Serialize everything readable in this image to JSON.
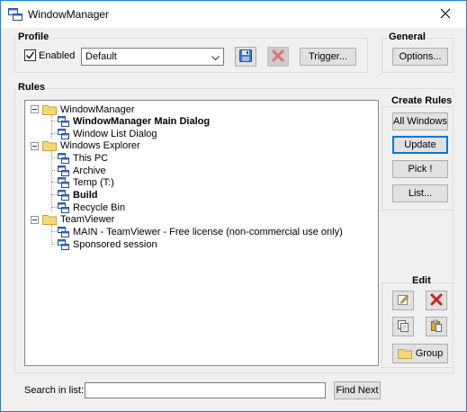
{
  "window": {
    "title": "WindowManager",
    "title_icon": "windows-icon",
    "close_icon": "close-icon"
  },
  "profile": {
    "group_label": "Profile",
    "enabled_label": "Enabled",
    "enabled_checked": true,
    "selected_profile": "Default",
    "save_icon": "floppy-disk-icon",
    "delete_icon": "red-x-icon",
    "trigger_label": "Trigger..."
  },
  "general": {
    "group_label": "General",
    "options_label": "Options..."
  },
  "rules": {
    "group_label": "Rules",
    "tree": [
      {
        "label": "WindowManager",
        "type": "folder",
        "bold": false,
        "expanded": true,
        "children": [
          {
            "label": "WindowManager Main Dialog",
            "type": "window",
            "bold": true
          },
          {
            "label": "Window List Dialog",
            "type": "window",
            "bold": false
          }
        ]
      },
      {
        "label": "Windows Explorer",
        "type": "folder",
        "bold": false,
        "expanded": true,
        "children": [
          {
            "label": "This PC",
            "type": "window",
            "bold": false
          },
          {
            "label": "Archive",
            "type": "window",
            "bold": false
          },
          {
            "label": "Temp (T:)",
            "type": "window",
            "bold": false
          },
          {
            "label": "Build",
            "type": "window",
            "bold": true
          },
          {
            "label": "Recycle Bin",
            "type": "window",
            "bold": false
          }
        ]
      },
      {
        "label": "TeamViewer",
        "type": "folder",
        "bold": false,
        "expanded": true,
        "children": [
          {
            "label": "MAIN - TeamViewer - Free license (non-commercial use only)",
            "type": "window",
            "bold": false
          },
          {
            "label": "Sponsored session",
            "type": "window",
            "bold": false
          }
        ]
      }
    ]
  },
  "create_rules": {
    "group_label": "Create Rules",
    "all_windows_label": "All Windows",
    "update_label": "Update",
    "pick_label": "Pick !",
    "list_label": "List..."
  },
  "edit": {
    "group_label": "Edit",
    "edit_icon": "pencil-icon",
    "delete_icon": "red-x-icon",
    "copy_icon": "copy-icon",
    "paste_icon": "paste-icon",
    "group_button_label": "Group",
    "group_icon": "folder-icon"
  },
  "search": {
    "label": "Search in list:",
    "value": "",
    "find_next_label": "Find Next"
  }
}
